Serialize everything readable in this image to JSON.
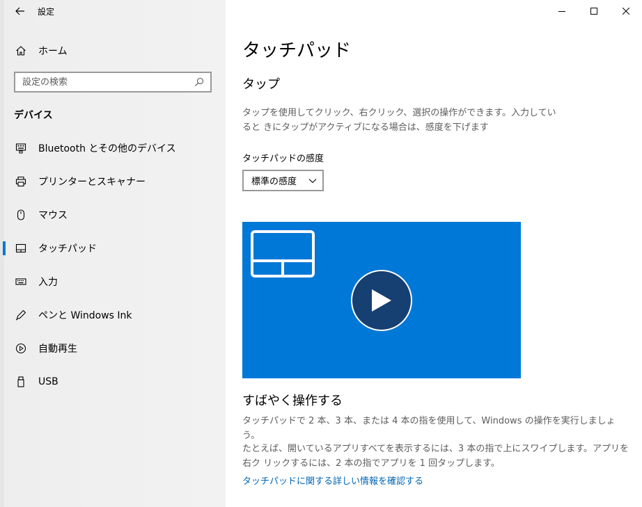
{
  "app": {
    "title": "設定"
  },
  "sidebar": {
    "home_label": "ホーム",
    "search_placeholder": "設定の検索",
    "section_title": "デバイス",
    "items": [
      {
        "label": "Bluetooth とその他のデバイス",
        "icon": "bluetooth-devices-icon",
        "selected": false
      },
      {
        "label": "プリンターとスキャナー",
        "icon": "printer-icon",
        "selected": false
      },
      {
        "label": "マウス",
        "icon": "mouse-icon",
        "selected": false
      },
      {
        "label": "タッチパッド",
        "icon": "touchpad-icon",
        "selected": true
      },
      {
        "label": "入力",
        "icon": "keyboard-icon",
        "selected": false
      },
      {
        "label": "ペンと Windows Ink",
        "icon": "pen-icon",
        "selected": false
      },
      {
        "label": "自動再生",
        "icon": "autoplay-icon",
        "selected": false
      },
      {
        "label": "USB",
        "icon": "usb-icon",
        "selected": false
      }
    ]
  },
  "main": {
    "page_title": "タッチパッド",
    "tap_heading": "タップ",
    "tap_description": "タップを使用してクリック、右クリック、選択の操作ができます。入力していると きにタップがアクティブになる場合は、感度を下げます",
    "sensitivity_label": "タッチパッドの感度",
    "sensitivity_value": "標準の感度",
    "video_play_icon": "play-icon",
    "quick_heading": "すばやく操作する",
    "quick_description_1": "タッチパッドで 2 本、3 本、または 4 本の指を使用して、Windows の操作を実行しましょう。",
    "quick_description_2": "たとえば、開いているアプリすべてを表示するには、3 本の指で上にスワイプします。アプリを右ク リックするには、2 本の指でアプリを 1 回タップします。",
    "more_info_link": "タッチパッドに関する詳しい情報を確認する"
  },
  "colors": {
    "accent": "#0078d7",
    "sidebar_bg": "#f0f0f0",
    "link": "#0066b4",
    "play_button": "#163f72"
  }
}
